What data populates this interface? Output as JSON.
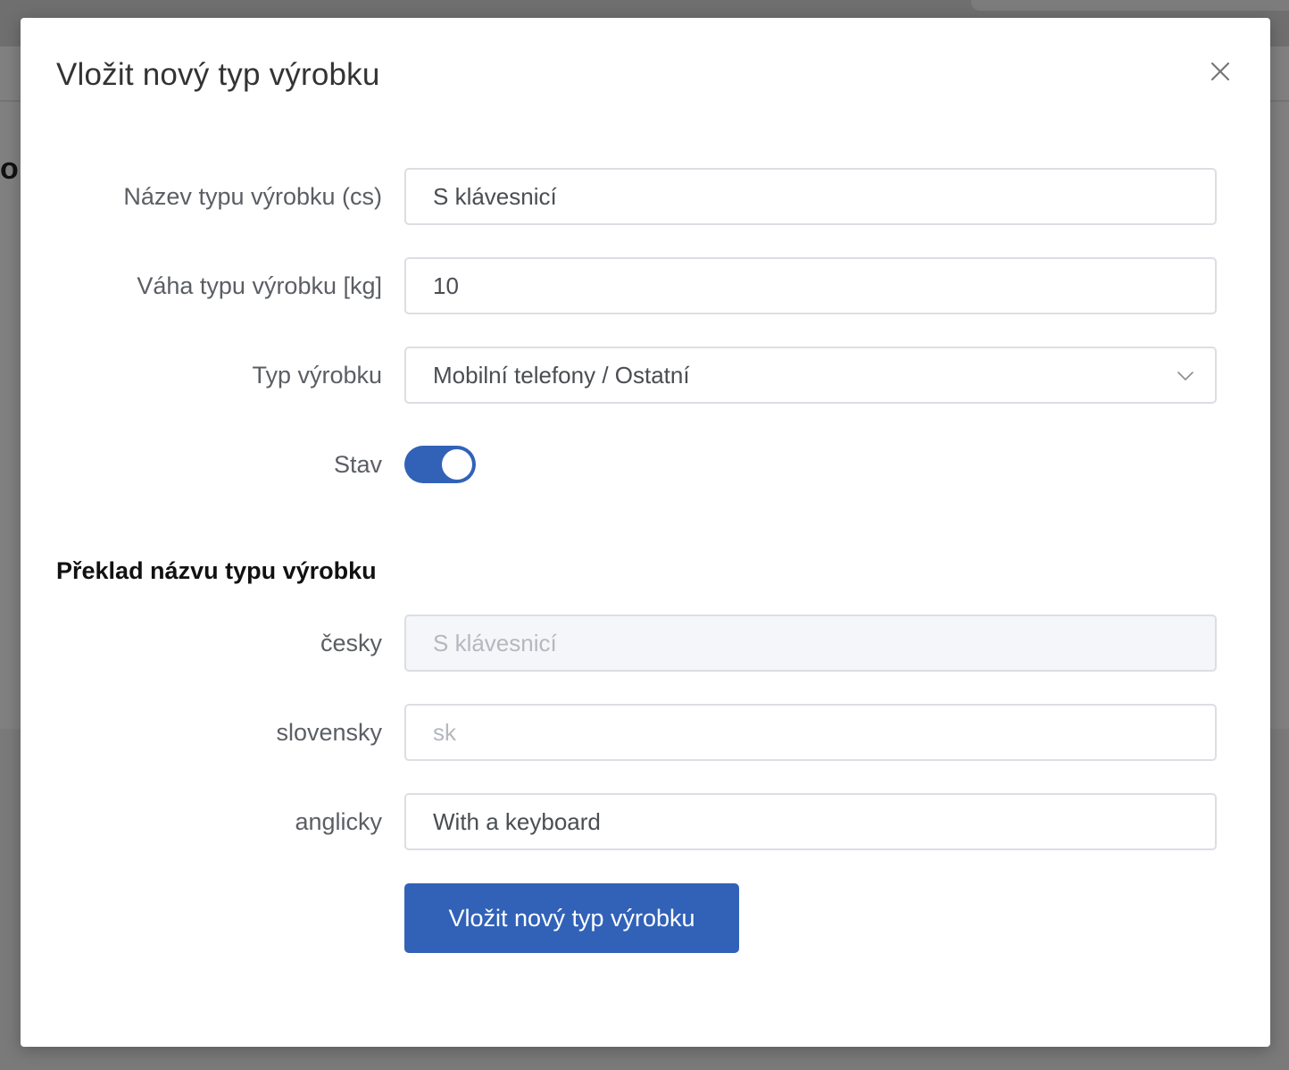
{
  "backdrop": {
    "partial_heading": "o"
  },
  "modal": {
    "title": "Vložit nový typ výrobku",
    "close_icon": "close-icon"
  },
  "form": {
    "name": {
      "label": "Název typu výrobku (cs)",
      "value": "S klávesnicí"
    },
    "weight": {
      "label": "Váha typu výrobku [kg]",
      "value": "10"
    },
    "type": {
      "label": "Typ výrobku",
      "selected": "Mobilní telefony / Ostatní",
      "icon": "chevron-down-icon"
    },
    "status": {
      "label": "Stav",
      "enabled": true,
      "color": "#3162b8"
    }
  },
  "translation": {
    "section_title": "Překlad názvu typu výrobku",
    "cs": {
      "label": "česky",
      "placeholder": "S klávesnicí"
    },
    "sk": {
      "label": "slovensky",
      "placeholder": "sk"
    },
    "en": {
      "label": "anglicky",
      "value": "With a keyboard"
    }
  },
  "submit": {
    "label": "Vložit nový typ výrobku",
    "color": "#3162b8"
  }
}
